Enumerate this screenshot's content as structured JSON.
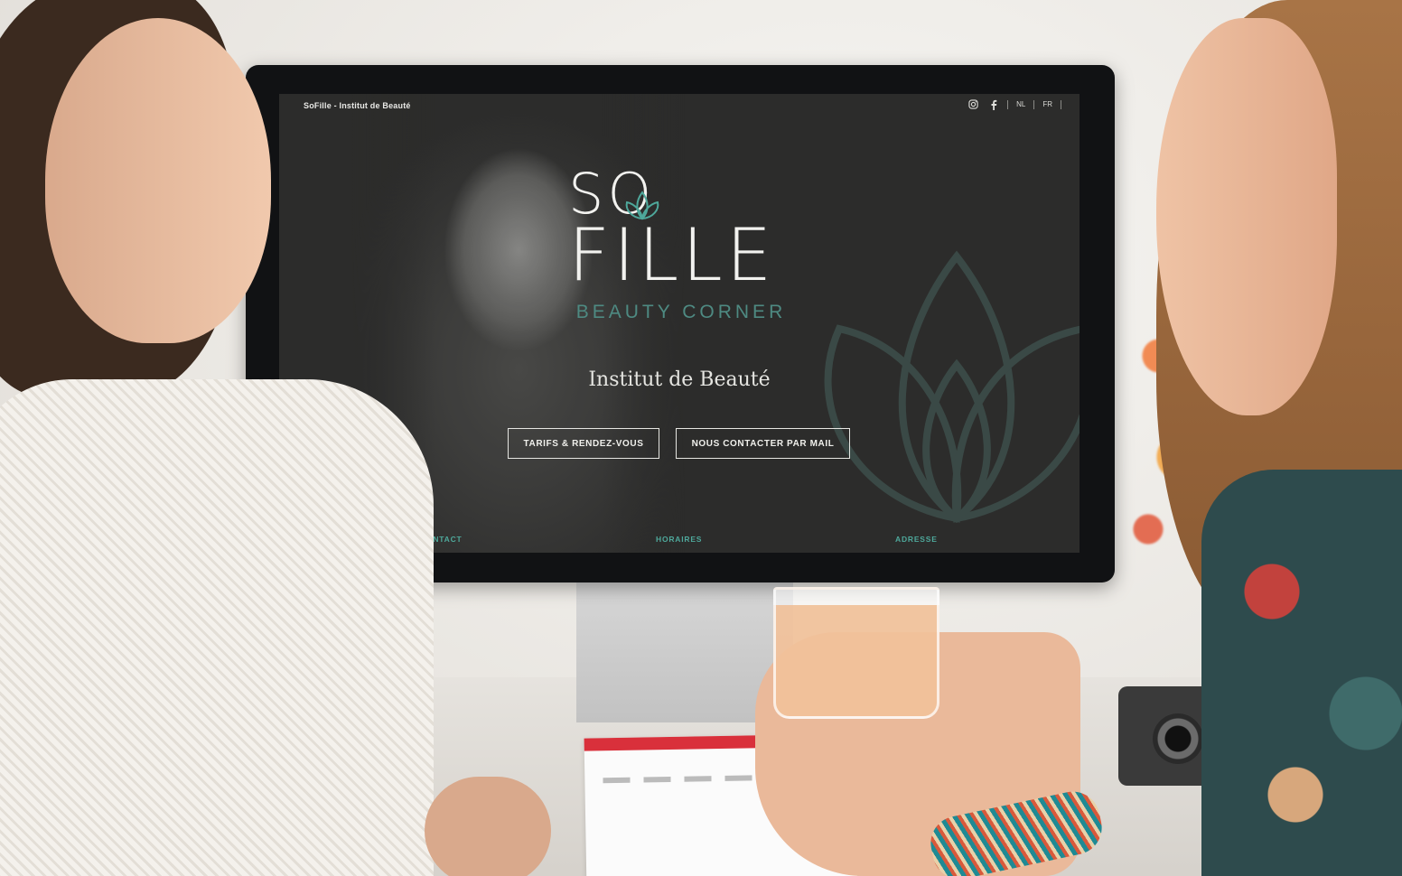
{
  "site": {
    "browser_title": "SoFille - Institut de Beauté",
    "nav": {
      "instagram": "instagram-icon",
      "facebook": "facebook-icon",
      "lang_nl": "NL",
      "lang_fr": "FR"
    },
    "logo": {
      "line1": "SO",
      "line2": "FILLE",
      "tagline": "BEAUTY CORNER"
    },
    "subtitle": "Institut de Beauté",
    "buttons": {
      "tarifs": "TARIFS & RENDEZ-VOUS",
      "contact_mail": "NOUS CONTACTER PAR MAIL"
    },
    "footer": {
      "contact": "CONTACT",
      "horaires": "HORAIRES",
      "adresse": "ADRESSE"
    }
  },
  "colors": {
    "screen_bg": "#2c2c2b",
    "accent_teal": "#4ea89b",
    "tagline_teal": "#4e8a82",
    "text_light": "#f2f2ef"
  }
}
